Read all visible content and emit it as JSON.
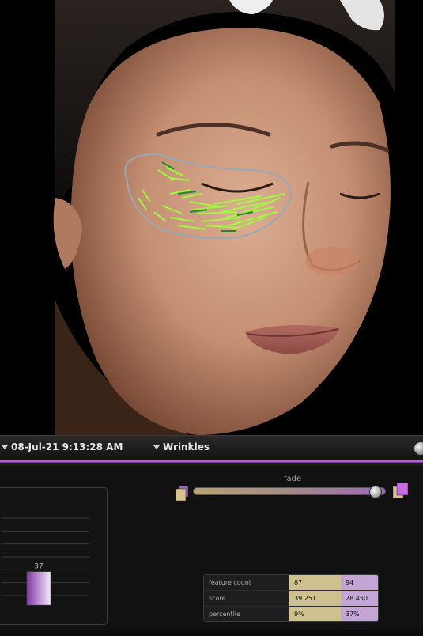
{
  "header": {
    "date_label": "08-Jul-21 9:13:28 AM",
    "metric_label": "Wrinkles"
  },
  "fade": {
    "label": "fade",
    "level": 0.93
  },
  "chart_data": {
    "type": "bar",
    "categories": [
      ""
    ],
    "values": [
      37
    ],
    "data_labels": [
      "37"
    ],
    "ylim": [
      0,
      100
    ],
    "grid": true,
    "colors": [
      "#8a4aa8",
      "#e8d8f0"
    ]
  },
  "stats": {
    "rows": [
      {
        "label": "feature count",
        "a": "87",
        "b": "94"
      },
      {
        "label": "score",
        "a": "39.251",
        "b": "28.450"
      },
      {
        "label": "percentile",
        "a": "9%",
        "b": "37%"
      }
    ]
  },
  "colors": {
    "accent_purple": "#b06ad0",
    "compare_tan": "#cfc08f",
    "compare_purple": "#c3a6d6",
    "overlay_green": "#9cff3a",
    "overlay_outline": "#9aa8b4"
  },
  "icons": {
    "dropdown": "triangle-down-icon",
    "round_button": "circle-button-icon"
  }
}
